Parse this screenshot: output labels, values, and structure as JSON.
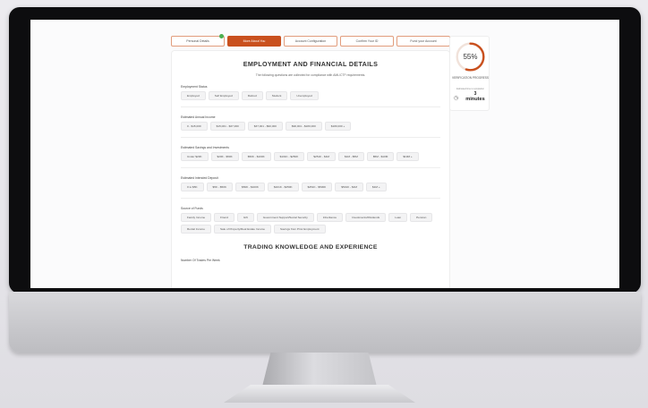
{
  "steps": [
    {
      "label": "Personal Details",
      "active": false,
      "completed": true
    },
    {
      "label": "More About You",
      "active": true,
      "completed": false
    },
    {
      "label": "Account Configuration",
      "active": false,
      "completed": false
    },
    {
      "label": "Confirm Your ID",
      "active": false,
      "completed": false
    },
    {
      "label": "Fund your Account",
      "active": false,
      "completed": false
    }
  ],
  "form": {
    "heading": "EMPLOYMENT AND FINANCIAL DETAILS",
    "subtext": "The following questions are collected for compliance with AML/CTF requirements.",
    "sections": [
      {
        "label": "Employment Status",
        "options": [
          "Employed",
          "Self Employed",
          "Retired",
          "Student",
          "Unemployed"
        ]
      },
      {
        "label": "Estimated Annual Income",
        "options": [
          "0 - $15,000",
          "$15,001 - $37,000",
          "$37,001 - $90,000",
          "$90,001 - $180,000",
          "$180,000 +"
        ]
      },
      {
        "label": "Estimated Savings and Investments",
        "options": [
          "Under $20K",
          "$20K - $50K",
          "$50K - $100K",
          "$101K - $250K",
          "$251K - $1M",
          "$1M - $5M",
          "$5M - $10M",
          "$10M +"
        ]
      },
      {
        "label": "Estimated Intended Deposit",
        "options": [
          "0 to $5K",
          "$5K - $50K",
          "$50K - $100K",
          "$101K - $250K",
          "$251K - $500K",
          "$501K - $1M",
          "$1M +"
        ]
      },
      {
        "label": "Source of Funds",
        "options": [
          "Family Income",
          "Friend",
          "Gift",
          "Government Support/Social Security",
          "Inheritance",
          "Investments/Dividends",
          "Loan",
          "Pension",
          "Rental Income",
          "Sale of Property/Real Estate Income",
          "Savings from Prior Employment"
        ]
      }
    ],
    "heading2": "TRADING KNOWLEDGE AND EXPERIENCE",
    "next_label": "Number Of Trades Per Week"
  },
  "progress": {
    "percent_text": "55%",
    "percent_value": 55,
    "label": "VERIFICATION PROGRESS",
    "estimate_label": "Estimated time to completion",
    "minutes_value": "3",
    "minutes_label": "minutes"
  },
  "colors": {
    "accent": "#c9501e",
    "accent_light": "#e29d7d",
    "complete": "#4caf50"
  }
}
